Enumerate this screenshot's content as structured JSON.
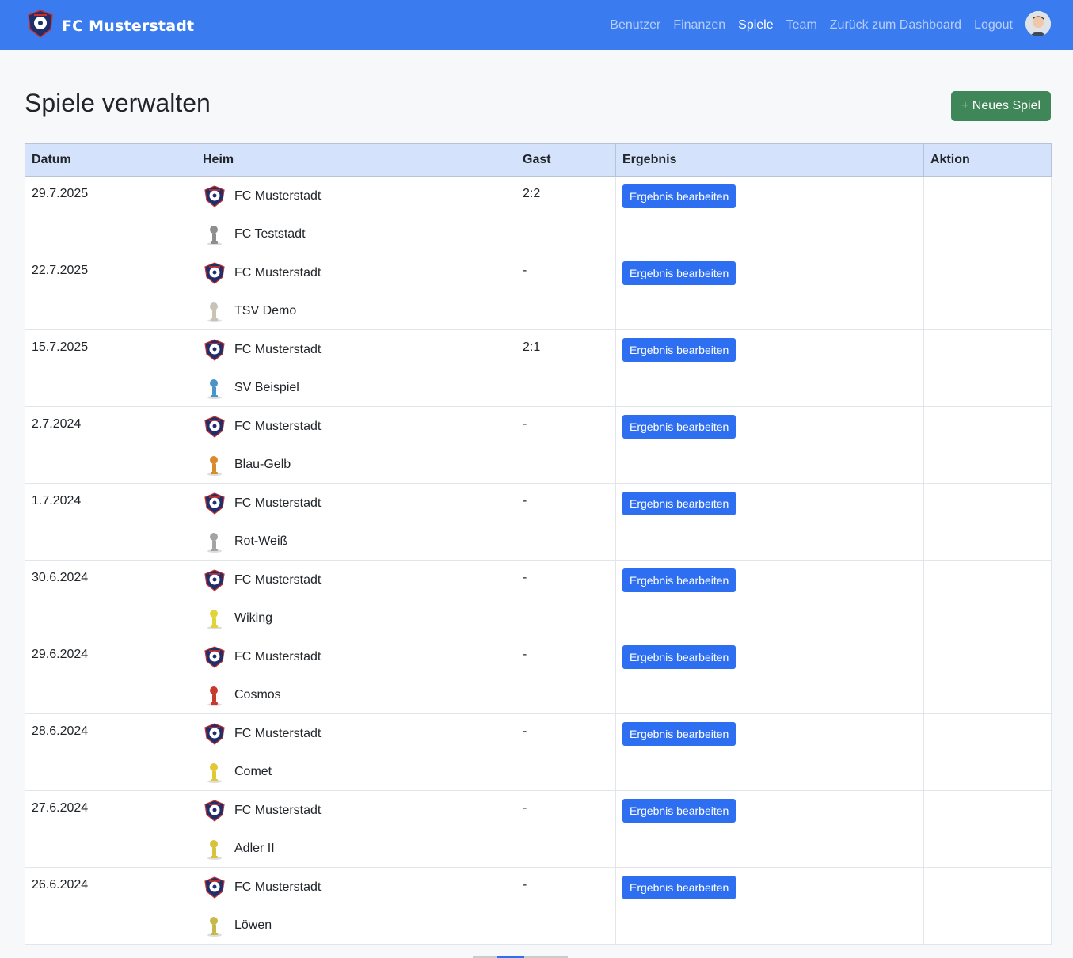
{
  "brand": {
    "name": "FC Musterstadt",
    "logo_icon": "club-crest-icon"
  },
  "nav": {
    "items": [
      {
        "label": "Benutzer",
        "active": false
      },
      {
        "label": "Finanzen",
        "active": false
      },
      {
        "label": "Spiele",
        "active": true
      },
      {
        "label": "Team",
        "active": false
      },
      {
        "label": "Zurück zum Dashboard",
        "active": false
      },
      {
        "label": "Logout",
        "active": false
      }
    ],
    "avatar_icon": "user-avatar-icon"
  },
  "page": {
    "title": "Spiele verwalten",
    "new_button_label": "+ Neues Spiel"
  },
  "table": {
    "headers": {
      "date": "Datum",
      "home": "Heim",
      "away": "Gast",
      "result": "Ergebnis",
      "action": "Aktion"
    },
    "edit_label": "Ergebnis bearbeiten",
    "home_team": "FC Musterstadt",
    "rows": [
      {
        "date": "29.7.2025",
        "home": "FC Musterstadt",
        "away": "FC Teststadt",
        "score": "2:2",
        "away_color": "#8e8e8e"
      },
      {
        "date": "22.7.2025",
        "home": "FC Musterstadt",
        "away": "TSV Demo",
        "score": "-",
        "away_color": "#c9c2b6"
      },
      {
        "date": "15.7.2025",
        "home": "FC Musterstadt",
        "away": "SV Beispiel",
        "score": "2:1",
        "away_color": "#4a94c8"
      },
      {
        "date": "2.7.2024",
        "home": "FC Musterstadt",
        "away": "Blau-Gelb",
        "score": "-",
        "away_color": "#d98a2b"
      },
      {
        "date": "1.7.2024",
        "home": "FC Musterstadt",
        "away": "Rot-Weiß",
        "score": "-",
        "away_color": "#a3a3a3"
      },
      {
        "date": "30.6.2024",
        "home": "FC Musterstadt",
        "away": "Wiking",
        "score": "-",
        "away_color": "#e3d33a"
      },
      {
        "date": "29.6.2024",
        "home": "FC Musterstadt",
        "away": "Cosmos",
        "score": "-",
        "away_color": "#c93a2e"
      },
      {
        "date": "28.6.2024",
        "home": "FC Musterstadt",
        "away": "Comet",
        "score": "-",
        "away_color": "#e0c935"
      },
      {
        "date": "27.6.2024",
        "home": "FC Musterstadt",
        "away": "Adler II",
        "score": "-",
        "away_color": "#d8c23c"
      },
      {
        "date": "26.6.2024",
        "home": "FC Musterstadt",
        "away": "Löwen",
        "score": "-",
        "away_color": "#c7b84a"
      }
    ]
  },
  "colors": {
    "navbar": "#3b7bf0",
    "header_bg": "#d4e3fb",
    "edit_button": "#2d6ff0",
    "new_button": "#3f8758"
  }
}
